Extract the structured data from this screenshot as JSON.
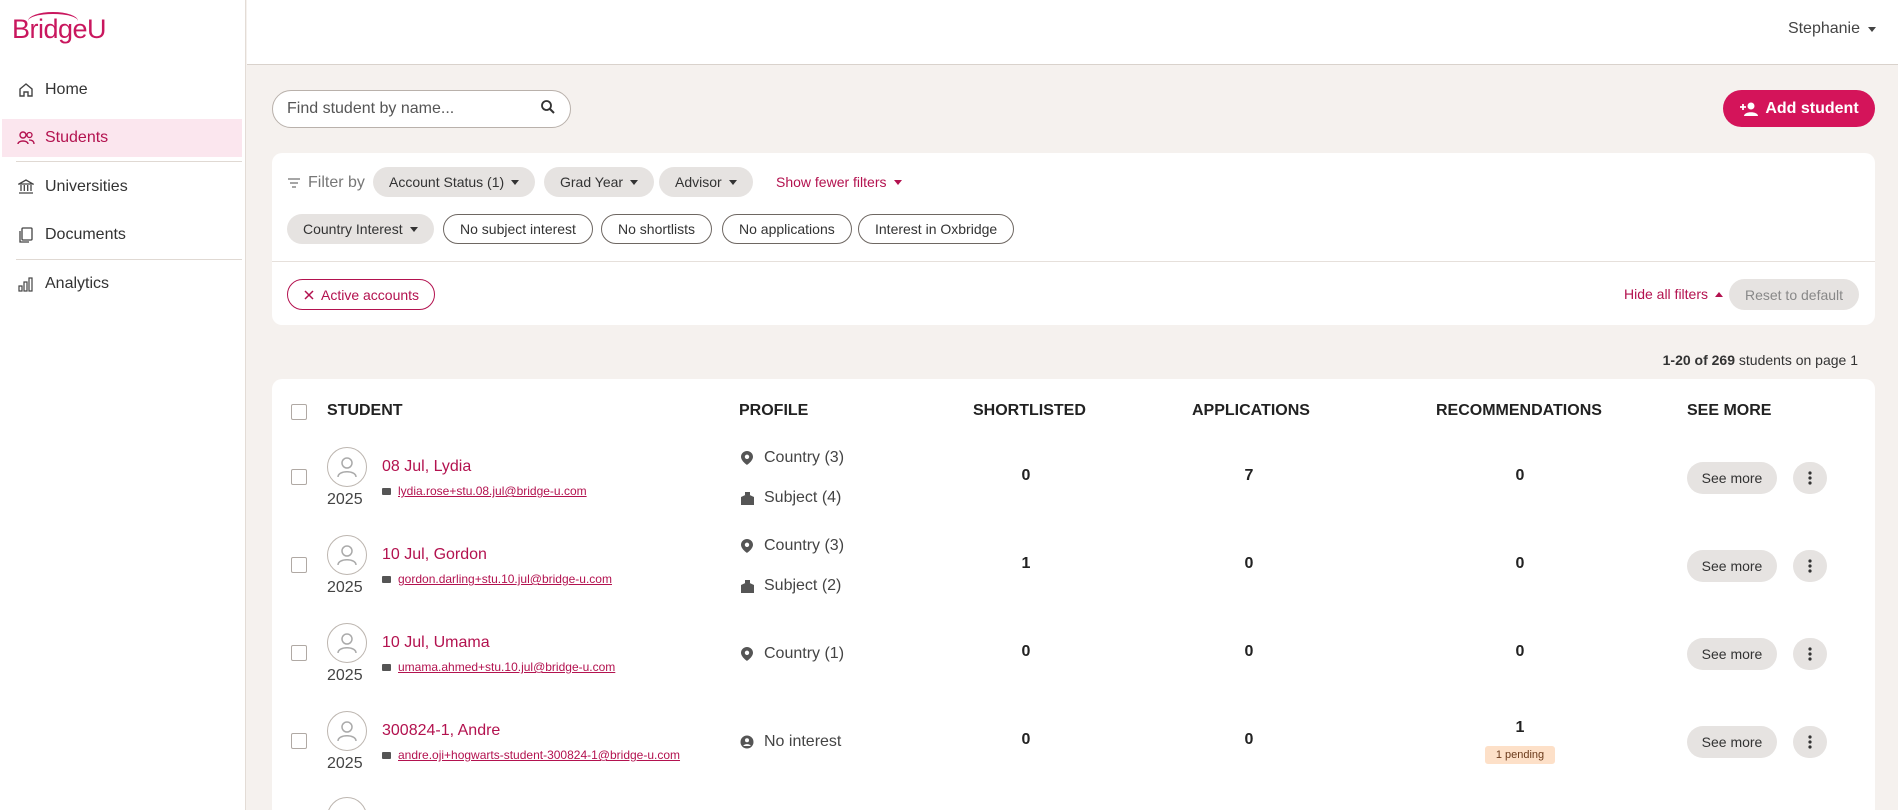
{
  "brand": {
    "name": "BridgeU",
    "color": "#c9175e"
  },
  "user": {
    "name": "Stephanie"
  },
  "sidebar": {
    "items": [
      {
        "label": "Home",
        "icon": "home-icon"
      },
      {
        "label": "Students",
        "icon": "users-icon",
        "active": true
      },
      {
        "label": "Universities",
        "icon": "university-icon"
      },
      {
        "label": "Documents",
        "icon": "documents-icon"
      },
      {
        "label": "Analytics",
        "icon": "analytics-icon"
      }
    ]
  },
  "search": {
    "placeholder": "Find student by name..."
  },
  "add_student": {
    "label": "Add student"
  },
  "filters": {
    "label": "Filter by",
    "dropdowns": [
      "Account Status (1)",
      "Grad Year",
      "Advisor",
      "Country Interest"
    ],
    "show_fewer": "Show fewer filters",
    "toggles": [
      "No subject interest",
      "No shortlists",
      "No applications",
      "Interest in Oxbridge"
    ],
    "active_chip": "Active accounts",
    "hide_all": "Hide all filters",
    "reset": "Reset to default"
  },
  "pagination": {
    "range": "1-20 of 269",
    "suffix": " students on page 1"
  },
  "table": {
    "headers": {
      "student": "STUDENT",
      "profile": "PROFILE",
      "shortlisted": "SHORTLISTED",
      "applications": "APPLICATIONS",
      "recommendations": "RECOMMENDATIONS",
      "see_more": "SEE MORE"
    },
    "see_more_label": "See more",
    "rows": [
      {
        "name": "08 Jul, Lydia",
        "year": "2025",
        "email": "lydia.rose+stu.08.jul@bridge-u.com",
        "profile": [
          {
            "icon": "location-pin-icon",
            "text": "Country (3)"
          },
          {
            "icon": "subject-box-icon",
            "text": "Subject (4)"
          }
        ],
        "shortlisted": "0",
        "applications": "7",
        "recommendations": "0",
        "badge": ""
      },
      {
        "name": "10 Jul, Gordon",
        "year": "2025",
        "email": "gordon.darling+stu.10.jul@bridge-u.com",
        "profile": [
          {
            "icon": "location-pin-icon",
            "text": "Country (3)"
          },
          {
            "icon": "subject-box-icon",
            "text": "Subject (2)"
          }
        ],
        "shortlisted": "1",
        "applications": "0",
        "recommendations": "0",
        "badge": ""
      },
      {
        "name": "10 Jul, Umama",
        "year": "2025",
        "email": "umama.ahmed+stu.10.jul@bridge-u.com",
        "profile": [
          {
            "icon": "location-pin-icon",
            "text": "Country (1)"
          }
        ],
        "shortlisted": "0",
        "applications": "0",
        "recommendations": "0",
        "badge": ""
      },
      {
        "name": "300824-1, Andre",
        "year": "2025",
        "email": "andre.oji+hogwarts-student-300824-1@bridge-u.com",
        "profile": [
          {
            "icon": "no-interest-icon",
            "text": "No interest"
          }
        ],
        "shortlisted": "0",
        "applications": "0",
        "recommendations": "1",
        "badge": "1 pending"
      }
    ]
  }
}
